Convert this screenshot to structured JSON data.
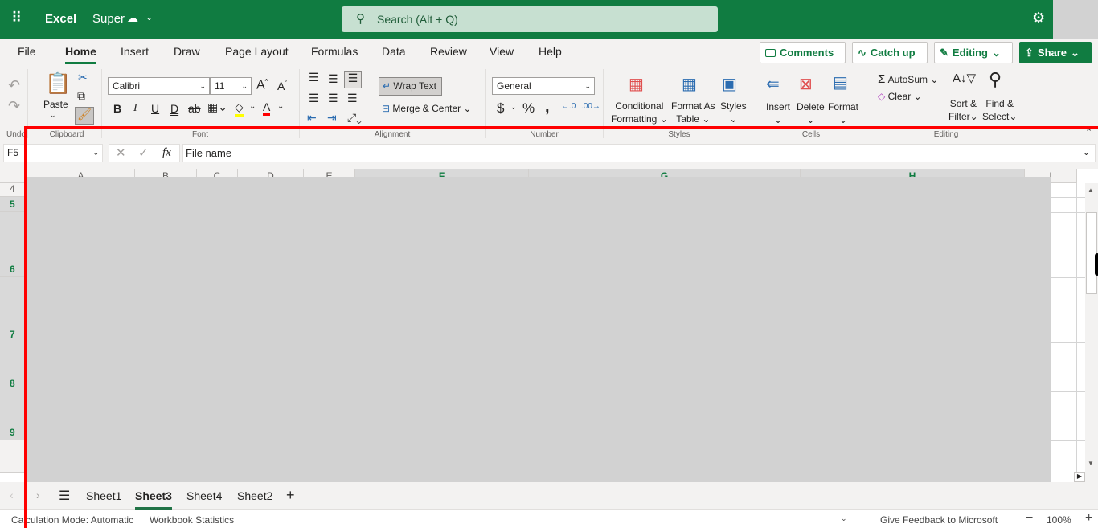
{
  "header": {
    "app_name": "Excel",
    "doc_name": "Super",
    "search_placeholder": "Search (Alt + Q)"
  },
  "menu_tabs": [
    {
      "label": "File"
    },
    {
      "label": "Home",
      "active": true
    },
    {
      "label": "Insert"
    },
    {
      "label": "Draw"
    },
    {
      "label": "Page Layout"
    },
    {
      "label": "Formulas"
    },
    {
      "label": "Data"
    },
    {
      "label": "Review"
    },
    {
      "label": "View"
    },
    {
      "label": "Help"
    }
  ],
  "actions": {
    "comments": "Comments",
    "catch_up": "Catch up",
    "editing": "Editing",
    "share": "Share"
  },
  "ribbon": {
    "groups": {
      "undo": "Undo",
      "clipboard": "Clipboard",
      "font": "Font",
      "alignment": "Alignment",
      "number": "Number",
      "styles": "Styles",
      "cells": "Cells",
      "editing": "Editing"
    },
    "paste": "Paste",
    "font_name": "Calibri",
    "font_size": "11",
    "wrap_text": "Wrap Text",
    "merge_center": "Merge & Center",
    "number_format": "General",
    "conditional_formatting": [
      "Conditional",
      "Formatting"
    ],
    "format_as_table": [
      "Format As",
      "Table"
    ],
    "styles": "Styles",
    "insert": "Insert",
    "delete": "Delete",
    "format": "Format",
    "autosum": "AutoSum",
    "clear": "Clear",
    "sort_filter": [
      "Sort &",
      "Filter"
    ],
    "find_select": [
      "Find &",
      "Select"
    ],
    "font_buttons": [
      "B",
      "I",
      "U",
      "D",
      "ab"
    ],
    "number_buttons": [
      "$",
      "%",
      ","
    ],
    "highlight_color": "#ffff00",
    "font_color": "#ff0000"
  },
  "formula_bar": {
    "name_box": "F5",
    "formula": "File name"
  },
  "grid": {
    "columns": [
      "A",
      "B",
      "C",
      "D",
      "E",
      "F",
      "G",
      "H",
      "I"
    ],
    "selected_columns": [
      "F",
      "G",
      "H"
    ],
    "rows": [
      "4",
      "5",
      "6",
      "7",
      "8",
      "9"
    ],
    "selected_rows": [
      "5",
      "6",
      "7",
      "8",
      "9"
    ]
  },
  "sheets": [
    {
      "label": "Sheet1"
    },
    {
      "label": "Sheet3",
      "active": true
    },
    {
      "label": "Sheet4"
    },
    {
      "label": "Sheet2"
    }
  ],
  "status": {
    "calc_mode": "Calculation Mode: Automatic",
    "stats": "Workbook Statistics",
    "feedback": "Give Feedback to Microsoft",
    "zoom": "100%"
  },
  "colors": {
    "brand": "#107c41",
    "annotation": "#ff0000",
    "overlay": "#d2d2d2"
  }
}
